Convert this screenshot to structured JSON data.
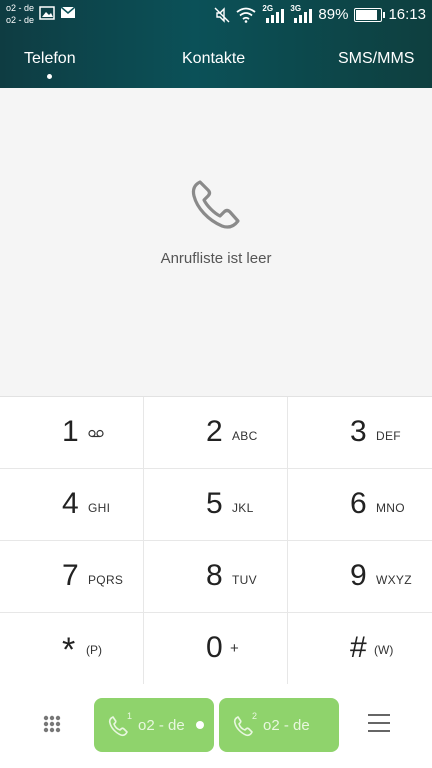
{
  "status_bar": {
    "carrier_1": "o2 - de",
    "carrier_2": "o2 - de",
    "network_1": "2G",
    "network_2": "3G",
    "battery_percent": "89%",
    "battery_level": 0.89,
    "time": "16:13",
    "icons": [
      "gallery-icon",
      "mail-icon",
      "mute-icon",
      "wifi-icon",
      "signal-icon",
      "battery-icon"
    ]
  },
  "tabs": [
    {
      "label": "Telefon",
      "active": true
    },
    {
      "label": "Kontakte",
      "active": false
    },
    {
      "label": "SMS/MMS",
      "active": false
    }
  ],
  "empty_state": {
    "icon": "phone-icon",
    "message": "Anrufliste ist leer"
  },
  "keypad": {
    "keys": [
      {
        "digit": "1",
        "letters": ""
      },
      {
        "digit": "2",
        "letters": "ABC"
      },
      {
        "digit": "3",
        "letters": "DEF"
      },
      {
        "digit": "4",
        "letters": "GHI"
      },
      {
        "digit": "5",
        "letters": "JKL"
      },
      {
        "digit": "6",
        "letters": "MNO"
      },
      {
        "digit": "7",
        "letters": "PQRS"
      },
      {
        "digit": "8",
        "letters": "TUV"
      },
      {
        "digit": "9",
        "letters": "WXYZ"
      },
      {
        "digit": "*",
        "letters": "(P)"
      },
      {
        "digit": "0",
        "letters": "+"
      },
      {
        "digit": "#",
        "letters": "(W)"
      }
    ],
    "voicemail_icon": "voicemail-icon"
  },
  "bottom_bar": {
    "call_sim_1": {
      "label": "o2 - de",
      "slot": "1"
    },
    "call_sim_2": {
      "label": "o2 - de",
      "slot": "2"
    },
    "accent_color": "#8fd36c"
  }
}
